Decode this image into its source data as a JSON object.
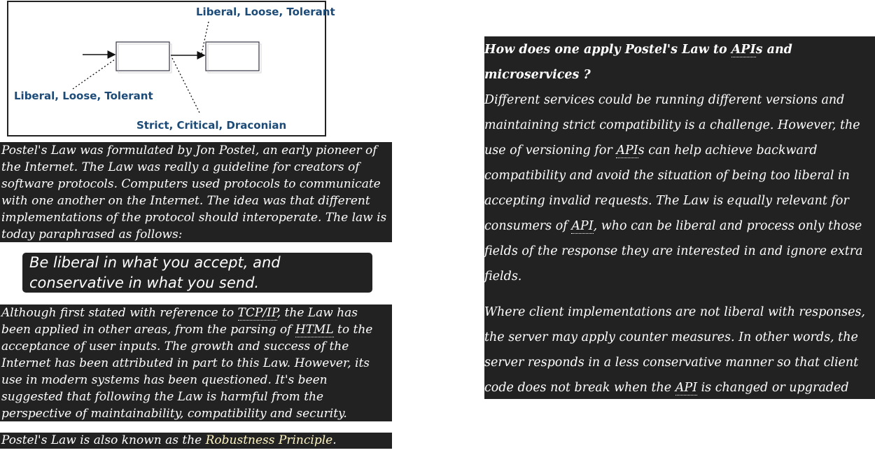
{
  "diagram": {
    "label_top": "Liberal, Loose, Tolerant",
    "label_left": "Liberal, Loose, Tolerant",
    "label_bottom": "Strict, Critical, Draconian"
  },
  "intro": "Postel's Law was formulated by Jon Postel, an early pioneer of the Internet. The Law was really a guideline for creators of software protocols. Computers used protocols to communicate with one another on the Internet. The idea was that different implementations of the protocol should interoperate. The law is today paraphrased as follows:",
  "quote": "Be liberal in what you accept, and conservative in what you send.",
  "history": {
    "t1": "Although first stated with reference to ",
    "abbr1": "TCP/IP",
    "t2": ",  the Law has been applied in other areas, from the parsing of ",
    "abbr2": "HTML",
    "t3": " to the acceptance of user inputs.  The growth and success of the Internet has been attributed in part to this Law.  However, its use in modern systems has been questioned. It's been suggested that following the Law is harmful from the perspective of maintainability, compatibility and security."
  },
  "alias": {
    "prefix": "Postel's Law is also known as the ",
    "highlight": "Robustness Principle",
    "suffix": "."
  },
  "right": {
    "question": {
      "t1": "How does one apply Postel's Law to ",
      "abbr": "API",
      "t2": "s and microservices ?"
    },
    "p1": {
      "t1": "Different services could be running different versions and maintaining strict compatibility is a challenge. However, the use of versioning for ",
      "abbr1": "API",
      "t2": "s can help achieve backward compatibility and avoid the situation of being too liberal in accepting invalid requests. The Law is equally relevant for consumers of ",
      "abbr2": "API",
      "t3": ", who can be liberal and process only those fields of the response they are interested in and ignore extra fields."
    },
    "p2": {
      "t1": "Where client implementations are not liberal with responses, the server may apply counter measures. In other words, the server responds in a less conservative manner so that client code does not break when the ",
      "abbr": "API",
      "t2": " is changed or upgraded later. This is an example of applying the Law selectively."
    }
  }
}
